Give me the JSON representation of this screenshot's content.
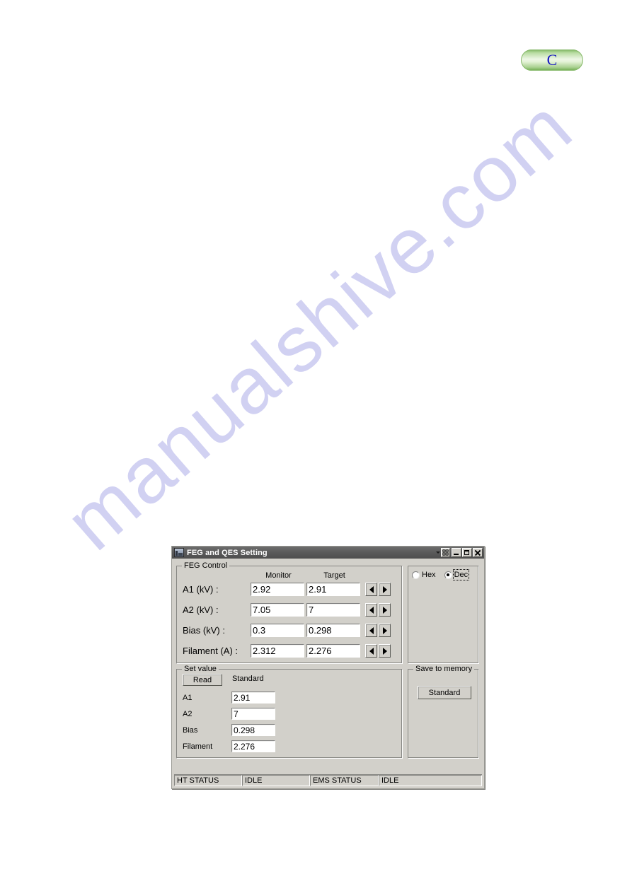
{
  "page": {
    "watermark": "manualshive.com",
    "badge_letter": "C",
    "badge_color": "#6ba84a",
    "badge_letter_color": "#1515c0"
  },
  "window": {
    "title": "FEG and QES Setting",
    "icon": "application-icon",
    "titlebar_color": "#5b5b5b",
    "face_color": "#d2d0ca",
    "buttons": {
      "menu_arrow": "▼",
      "system": "system-menu",
      "minimize": "Minimize",
      "maximize": "Maximize",
      "close": "Close"
    }
  },
  "feg_control": {
    "title": "FEG Control",
    "columns": [
      "Monitor",
      "Target"
    ],
    "rows": [
      {
        "label": "A1 (kV) :",
        "monitor": "2.92",
        "target": "2.91",
        "dec_label": "decrement",
        "inc_label": "increment"
      },
      {
        "label": "A2 (kV) :",
        "monitor": "7.05",
        "target": "7",
        "dec_label": "decrement",
        "inc_label": "increment"
      },
      {
        "label": "Bias (kV) :",
        "monitor": "0.3",
        "target": "0.298",
        "dec_label": "decrement",
        "inc_label": "increment"
      },
      {
        "label": "Filament (A) :",
        "monitor": "2.312",
        "target": "2.276",
        "dec_label": "decrement",
        "inc_label": "increment"
      }
    ]
  },
  "mode_group": {
    "options": [
      {
        "label": "Hex",
        "selected": false,
        "focused": false
      },
      {
        "label": "Dec",
        "selected": true,
        "focused": true
      }
    ]
  },
  "set_value": {
    "title": "Set value",
    "read_button": "Read",
    "column_header": "Standard",
    "rows": [
      {
        "label": "A1",
        "value": "2.91"
      },
      {
        "label": "A2",
        "value": "7"
      },
      {
        "label": "Bias",
        "value": "0.298"
      },
      {
        "label": "Filament",
        "value": "2.276"
      }
    ]
  },
  "save_to_memory": {
    "title": "Save to memory",
    "button": "Standard"
  },
  "status_bar": {
    "cells": [
      {
        "label": "HT STATUS"
      },
      {
        "label": "IDLE"
      },
      {
        "label": "EMS STATUS"
      },
      {
        "label": "IDLE"
      }
    ]
  }
}
